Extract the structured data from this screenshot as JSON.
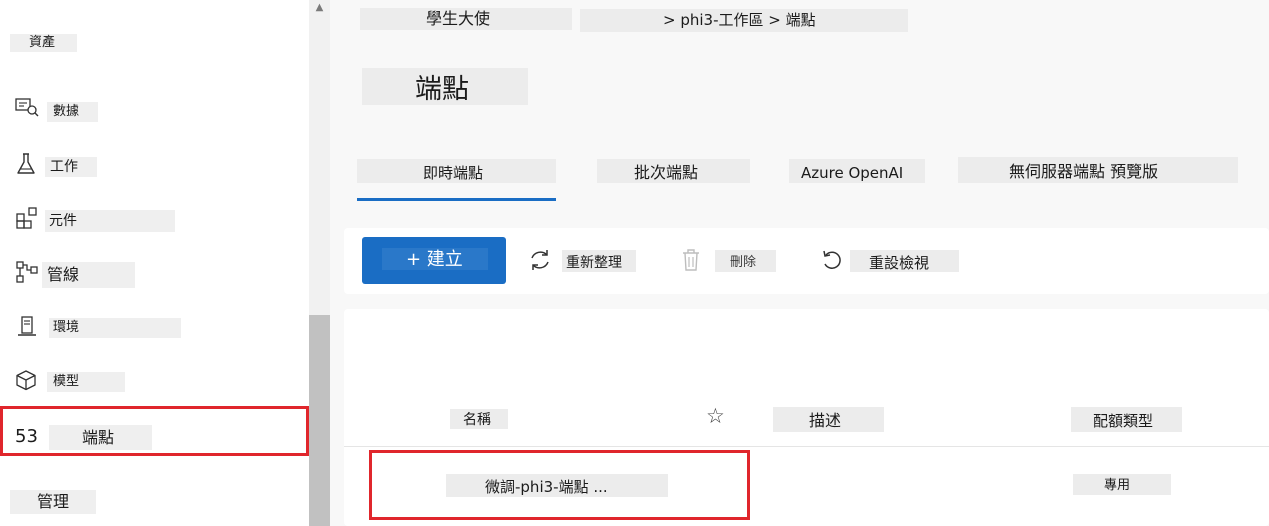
{
  "sidebar": {
    "assets_heading": "資產",
    "items": [
      {
        "label": "數據",
        "icon": "data-icon"
      },
      {
        "label": "工作",
        "icon": "flask-icon"
      },
      {
        "label": "元件",
        "icon": "components-icon"
      },
      {
        "label": "管線",
        "icon": "pipeline-icon"
      },
      {
        "label": "環境",
        "icon": "environment-icon"
      },
      {
        "label": "模型",
        "icon": "cube-icon"
      },
      {
        "label": "端點",
        "prefix": "53"
      }
    ],
    "manage_heading": "管理"
  },
  "breadcrumb": {
    "root": "學生大使",
    "path": "> phi3-工作區 > 端點"
  },
  "page_title": "端點",
  "tabs": [
    {
      "label": "即時端點",
      "active": true
    },
    {
      "label": "批次端點",
      "active": false
    },
    {
      "label": "Azure OpenAI",
      "active": false
    },
    {
      "label": "無伺服器端點 預覽版",
      "active": false
    }
  ],
  "toolbar": {
    "create_label": "+ 建立",
    "refresh_label": "重新整理",
    "delete_label": "刪除",
    "reset_label": "重設檢視"
  },
  "table": {
    "columns": {
      "name": "名稱",
      "favorite": "☆",
      "description": "描述",
      "quota": "配額類型"
    },
    "rows": [
      {
        "name": "微調-phi3-端點 ...",
        "quota": "專用"
      }
    ]
  },
  "colors": {
    "accent": "#1a6dc4",
    "highlight": "#e0262c"
  }
}
